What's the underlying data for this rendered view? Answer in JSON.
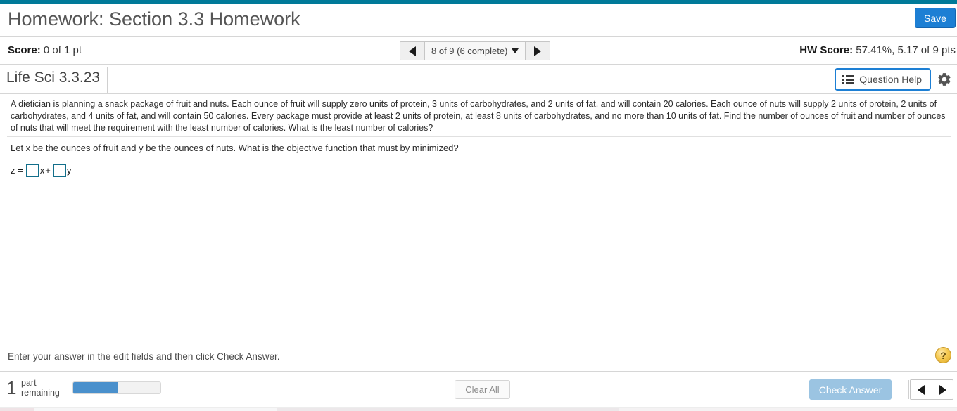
{
  "header": {
    "title": "Homework: Section 3.3 Homework",
    "save_label": "Save"
  },
  "score_bar": {
    "score_label": "Score:",
    "score_value": " 0 of 1 pt",
    "pager_label": "8 of 9 (6 complete)",
    "prev_icon": "triangle-left-icon",
    "next_icon": "triangle-right-icon",
    "hw_score_label": "HW Score:",
    "hw_score_value": " 57.41%, 5.17 of 9 pts"
  },
  "question_header": {
    "question_id": "Life Sci 3.3.23",
    "question_help_label": "Question Help",
    "help_icon": "list-icon",
    "gear_icon": "gear-icon"
  },
  "problem": {
    "statement": "A dietician is planning a snack package of fruit and nuts. Each ounce of fruit will supply zero units of protein, 3 units of carbohydrates, and 2 units of fat, and will contain 20 calories. Each ounce of nuts will supply 2 units of protein, 2 units of carbohydrates, and 4 units of fat, and will contain 50 calories. Every package must provide at least 2 units of protein, at least 8 units of carbohydrates, and no more than 10 units of fat. Find the number of ounces of fruit and number of ounces of nuts that will meet the requirement with the least number of calories. What is the least number of calories?",
    "sub_question": "Let x be the ounces of fruit and y be the ounces of nuts. What is the objective function that must by minimized?",
    "equation": {
      "lhs": "z =",
      "coef_x_value": "",
      "var_x": "x",
      "operator": "+",
      "coef_y_value": "",
      "var_y": "y"
    }
  },
  "footer": {
    "instruction": "Enter your answer in the edit fields and then click Check Answer.",
    "help_bubble_icon": "question-mark-icon",
    "help_bubble_glyph": "?",
    "parts_count": "1",
    "parts_label": "part remaining",
    "progress_percent": 52,
    "clear_all_label": "Clear All",
    "check_answer_label": "Check Answer",
    "prev_icon": "triangle-left-icon",
    "next_icon": "triangle-right-icon"
  },
  "colors": {
    "teal_strip": "#007a99",
    "save_blue": "#1d7fd4",
    "help_border_blue": "#1d7fd4",
    "input_border_teal": "#136f8b",
    "progress_blue": "#4a90cc",
    "check_btn_disabled": "#9bc4e2",
    "help_bubble_gold": "#f5c84e"
  }
}
